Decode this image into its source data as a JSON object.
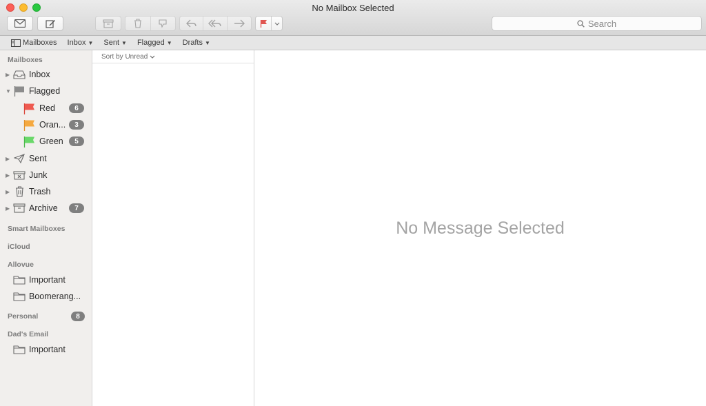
{
  "window": {
    "title": "No Mailbox Selected"
  },
  "toolbar": {
    "search_placeholder": "Search",
    "icons": [
      "envelope-icon",
      "compose-icon",
      "archive-icon",
      "trash-icon",
      "junk-icon",
      "reply-icon",
      "reply-all-icon",
      "forward-icon",
      "flag-icon",
      "chevron-down-icon"
    ]
  },
  "favorites": {
    "mailboxes_label": "Mailboxes",
    "items": [
      {
        "label": "Inbox"
      },
      {
        "label": "Sent"
      },
      {
        "label": "Flagged"
      },
      {
        "label": "Drafts"
      }
    ]
  },
  "sidebar": {
    "mailboxes_header": "Mailboxes",
    "items": [
      {
        "label": "Inbox",
        "icon": "inbox-tray-icon"
      },
      {
        "label": "Flagged",
        "icon": "flag-icon"
      },
      {
        "label": "Red",
        "icon": "red-flag-icon",
        "count": "6",
        "color": "#e74c3c"
      },
      {
        "label": "Oran...",
        "icon": "orange-flag-icon",
        "count": "3",
        "color": "#f0a030"
      },
      {
        "label": "Green",
        "icon": "green-flag-icon",
        "count": "5",
        "color": "#5ccd5c"
      },
      {
        "label": "Sent",
        "icon": "paper-plane-icon"
      },
      {
        "label": "Junk",
        "icon": "junk-icon"
      },
      {
        "label": "Trash",
        "icon": "trash-icon"
      },
      {
        "label": "Archive",
        "icon": "archive-box-icon",
        "count": "7"
      }
    ],
    "smart_mailboxes_header": "Smart Mailboxes",
    "icloud_header": "iCloud",
    "allovue_header": "Allovue",
    "allovue_items": [
      {
        "label": "Important",
        "icon": "folder-icon"
      },
      {
        "label": "Boomerang...",
        "icon": "folder-icon"
      }
    ],
    "personal_header": "Personal",
    "personal_count": "8",
    "dads_email_header": "Dad's Email",
    "dads_email_items": [
      {
        "label": "Important",
        "icon": "folder-icon"
      }
    ]
  },
  "message_list": {
    "sort_label": "Sort by Unread"
  },
  "viewer": {
    "empty_text": "No Message Selected"
  }
}
